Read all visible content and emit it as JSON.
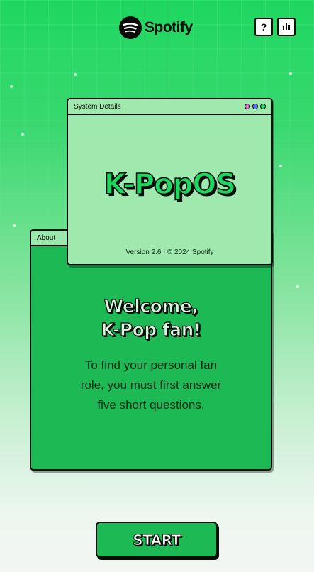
{
  "header": {
    "logo_text": "Spotify",
    "help_label": "?",
    "brand_color": "#1ed760"
  },
  "system_window": {
    "title": "System Details",
    "heading": "K-PopOS",
    "version_text": "Version 2.6 I © 2024 Spotify"
  },
  "about_window": {
    "title": "About",
    "welcome_line1": "Welcome,",
    "welcome_line2": "K-Pop fan!",
    "body_line1": "To find your personal fan",
    "body_line2": "role, you must first answer",
    "body_line3": "five short questions."
  },
  "start_button": {
    "label": "START"
  }
}
